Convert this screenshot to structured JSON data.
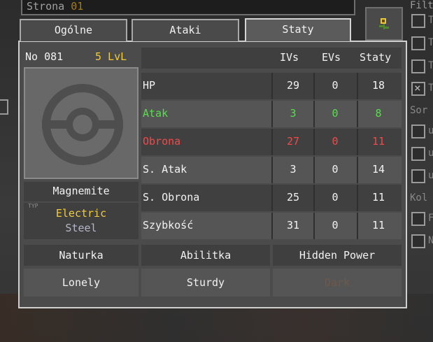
{
  "search": {
    "label": "Strona",
    "value": "01"
  },
  "filter_panel": {
    "heading": "Filt",
    "checkbox_labels": [
      "T",
      "T",
      "T",
      "T"
    ],
    "checked_index": 3,
    "section_sort": "Sor",
    "section_color": "Kol",
    "small_checkbox_labels": [
      "u",
      "u",
      "u"
    ],
    "lower_checkbox_labels": [
      "F",
      "N"
    ]
  },
  "tabs": [
    {
      "label": "Ogólne",
      "active": false
    },
    {
      "label": "Ataki",
      "active": false
    },
    {
      "label": "Staty",
      "active": true
    }
  ],
  "pokemon": {
    "number": "No 081",
    "level": "5 LvL",
    "name": "Magnemite",
    "type_label": "TYP",
    "type_primary": "Electric",
    "type_secondary": "Steel"
  },
  "stats": {
    "headers": {
      "ivs": "IVs",
      "evs": "EVs",
      "total": "Staty"
    },
    "rows": [
      {
        "name": "HP",
        "iv": "29",
        "ev": "0",
        "stat": "18",
        "color": "#f2f2f2"
      },
      {
        "name": "Atak",
        "iv": "3",
        "ev": "0",
        "stat": "8",
        "color": "#55e04a"
      },
      {
        "name": "Obrona",
        "iv": "27",
        "ev": "0",
        "stat": "11",
        "color": "#f04a4a"
      },
      {
        "name": "S. Atak",
        "iv": "3",
        "ev": "0",
        "stat": "14",
        "color": "#f2f2f2"
      },
      {
        "name": "S. Obrona",
        "iv": "25",
        "ev": "0",
        "stat": "11",
        "color": "#f2f2f2"
      },
      {
        "name": "Szybkość",
        "iv": "31",
        "ev": "0",
        "stat": "11",
        "color": "#f2f2f2"
      }
    ]
  },
  "details": {
    "nature_label": "Naturka",
    "nature_value": "Lonely",
    "ability_label": "Abilitka",
    "ability_value": "Sturdy",
    "hidden_power_label": "Hidden Power",
    "hidden_power_value": "Dark",
    "hidden_power_color": "#705848"
  }
}
